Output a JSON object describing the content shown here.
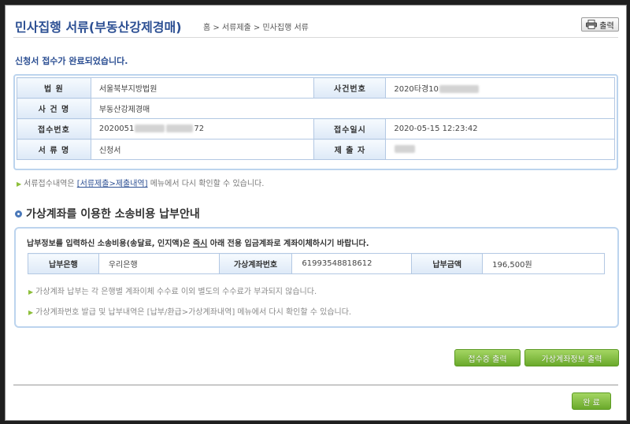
{
  "header": {
    "title": "민사집행 서류(부동산강제경매)",
    "breadcrumb": "홈 > 서류제출 > 민사집행 서류",
    "print_label": "출력"
  },
  "completion_message": "신청서 접수가 완료되었습니다.",
  "info_table": {
    "court_label": "법 원",
    "court_value": "서울북부지방법원",
    "case_no_label": "사건번호",
    "case_no_value": "2020타경10",
    "case_name_label": "사 건 명",
    "case_name_value": "부동산강제경매",
    "receipt_no_label": "접수번호",
    "receipt_no_prefix": "2020051",
    "receipt_no_suffix": "72",
    "receipt_date_label": "접수일시",
    "receipt_date_value": "2020-05-15 12:23:42",
    "doc_name_label": "서 류 명",
    "doc_name_value": "신청서",
    "submitter_label": "제 출 자"
  },
  "note1": {
    "prefix": "서류접수내역은 ",
    "link": "[서류제출>제출내역]",
    "suffix": " 메뉴에서 다시 확인할 수 있습니다."
  },
  "section_title": "가상계좌를 이용한 소송비용 납부안내",
  "payment": {
    "message_prefix": "납부정보를 입력하신 소송비용(송달료, 인지액)은 ",
    "message_emph": "즉시",
    "message_suffix": " 아래 전용 입금계좌로 계좌이체하시기 바랍니다.",
    "bank_label": "납부은행",
    "bank_value": "우리은행",
    "account_label": "가상계좌번호",
    "account_value": "61993548818612",
    "amount_label": "납부금액",
    "amount_value": "196,500원",
    "note_a": "가상계좌 납부는 각 은행별 계좌이체 수수료 이외 별도의 수수료가 부과되지 않습니다.",
    "note_b": "가상계좌번호 발급 및 납부내역은 [납부/환급>가상계좌내역] 메뉴에서 다시 확인할 수 있습니다."
  },
  "buttons": {
    "receipt_print": "접수증 출력",
    "account_print": "가상계좌정보 출력",
    "done": "완 료"
  },
  "colors": {
    "title_blue": "#2c4f93",
    "border_blue": "#bcd4ee",
    "button_green": "#7ab63a"
  }
}
